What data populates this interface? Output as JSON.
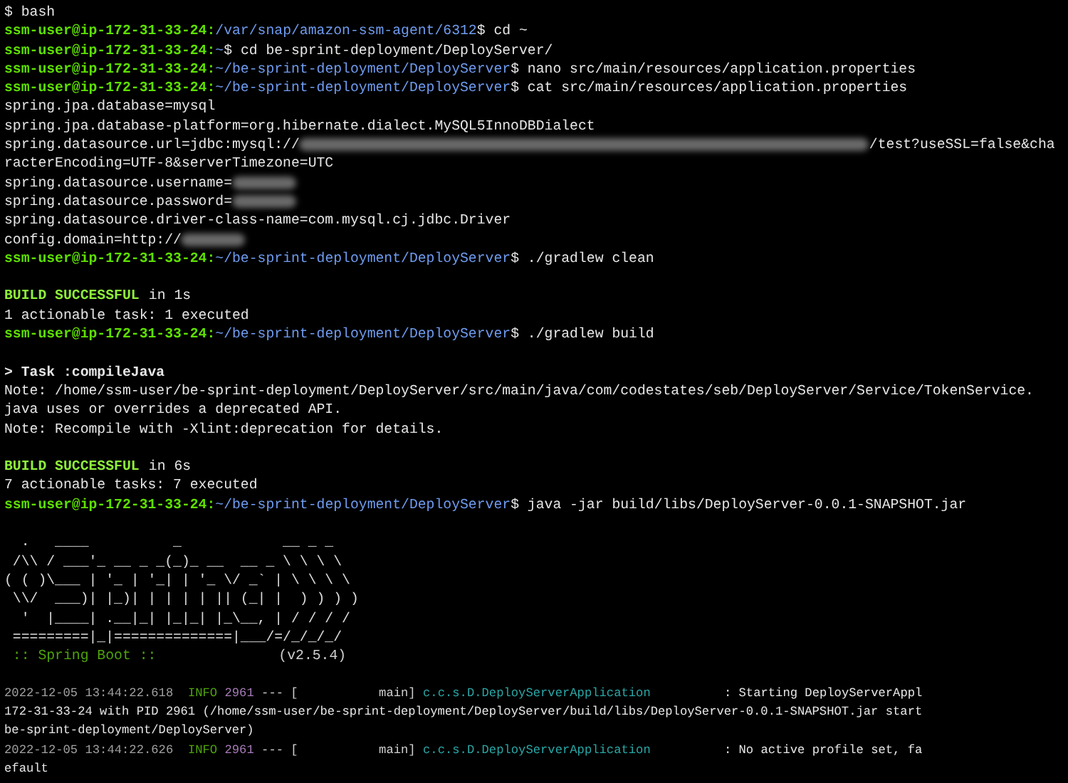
{
  "terminal": {
    "lines": [
      {
        "kind": "output",
        "text": "$ bash"
      },
      {
        "kind": "prompt",
        "host": "ssm-user@ip-172-31-33-24:",
        "path": "/var/snap/amazon-ssm-agent/6312",
        "command": "$ cd ~"
      },
      {
        "kind": "prompt",
        "host": "ssm-user@ip-172-31-33-24:",
        "path": "~",
        "command": "$ cd be-sprint-deployment/DeployServer/"
      },
      {
        "kind": "prompt",
        "host": "ssm-user@ip-172-31-33-24:",
        "path": "~/be-sprint-deployment/DeployServer",
        "command": "$ nano src/main/resources/application.properties"
      },
      {
        "kind": "prompt",
        "host": "ssm-user@ip-172-31-33-24:",
        "path": "~/be-sprint-deployment/DeployServer",
        "command": "$ cat src/main/resources/application.properties"
      },
      {
        "kind": "output",
        "text": "spring.jpa.database=mysql"
      },
      {
        "kind": "output",
        "text": "spring.jpa.database-platform=org.hibernate.dialect.MySQL5InnoDBDialect"
      },
      {
        "kind": "redacted",
        "prefix": "spring.datasource.url=jdbc:mysql://",
        "suffix": "/test?useSSL=false&cha"
      },
      {
        "kind": "output",
        "text": "racterEncoding=UTF-8&serverTimezone=UTC"
      },
      {
        "kind": "redacted",
        "prefix": "spring.datasource.username="
      },
      {
        "kind": "redacted",
        "prefix": "spring.datasource.password="
      },
      {
        "kind": "output",
        "text": "spring.datasource.driver-class-name=com.mysql.cj.jdbc.Driver"
      },
      {
        "kind": "redacted",
        "prefix": "config.domain=http://"
      },
      {
        "kind": "prompt",
        "host": "ssm-user@ip-172-31-33-24:",
        "path": "~/be-sprint-deployment/DeployServer",
        "command": "$ ./gradlew clean"
      },
      {
        "kind": "blank"
      },
      {
        "kind": "success",
        "status": "BUILD SUCCESSFUL",
        "text": "in 1s"
      },
      {
        "kind": "output",
        "text": "1 actionable task: 1 executed"
      },
      {
        "kind": "prompt",
        "host": "ssm-user@ip-172-31-33-24:",
        "path": "~/be-sprint-deployment/DeployServer",
        "command": "$ ./gradlew build"
      },
      {
        "kind": "blank"
      },
      {
        "kind": "task",
        "text": "> Task :compileJava"
      },
      {
        "kind": "output",
        "text": "Note: /home/ssm-user/be-sprint-deployment/DeployServer/src/main/java/com/codestates/seb/DeployServer/Service/TokenService."
      },
      {
        "kind": "output",
        "text": "java uses or overrides a deprecated API."
      },
      {
        "kind": "output",
        "text": "Note: Recompile with -Xlint:deprecation for details."
      },
      {
        "kind": "blank"
      },
      {
        "kind": "success",
        "status": "BUILD SUCCESSFUL",
        "text": "in 6s"
      },
      {
        "kind": "output",
        "text": "7 actionable tasks: 7 executed"
      },
      {
        "kind": "prompt",
        "host": "ssm-user@ip-172-31-33-24:",
        "path": "~/be-sprint-deployment/DeployServer",
        "command": "$ java -jar build/libs/DeployServer-0.0.1-SNAPSHOT.jar"
      },
      {
        "kind": "blank"
      },
      {
        "kind": "banner",
        "text": "  .   ____          _            __ _ _"
      },
      {
        "kind": "banner",
        "text": " /\\\\ / ___'_ __ _ _(_)_ __  __ _ \\ \\ \\ \\"
      },
      {
        "kind": "banner",
        "text": "( ( )\\___ | '_ | '_| | '_ \\/ _` | \\ \\ \\ \\"
      },
      {
        "kind": "banner",
        "text": " \\\\/  ___)| |_)| | | | | || (_| |  ) ) ) )"
      },
      {
        "kind": "banner",
        "text": "  '  |____| .__|_| |_|_| |_\\__, | / / / /"
      },
      {
        "kind": "banner",
        "text": " =========|_|==============|___/=/_/_/_/"
      },
      {
        "kind": "boot",
        "label": " :: Spring Boot ::",
        "version": "(v2.5.4)"
      },
      {
        "kind": "blank"
      },
      {
        "kind": "log",
        "time": "2022-12-05 13:44:22.618",
        "level": "INFO",
        "pid": "2961",
        "thread": "--- [           main]",
        "logger": "c.c.s.D.DeployServerApplication",
        "message": ": Starting DeployServerAppl"
      },
      {
        "kind": "output",
        "text": "172-31-33-24 with PID 2961 (/home/ssm-user/be-sprint-deployment/DeployServer/build/libs/DeployServer-0.0.1-SNAPSHOT.jar start",
        "small": true
      },
      {
        "kind": "output",
        "text": "be-sprint-deployment/DeployServer)",
        "small": true
      },
      {
        "kind": "log",
        "time": "2022-12-05 13:44:22.626",
        "level": "INFO",
        "pid": "2961",
        "thread": "--- [           main]",
        "logger": "c.c.s.D.DeployServerApplication",
        "message": ": No active profile set, fa"
      },
      {
        "kind": "output",
        "text": "efault",
        "small": true
      }
    ]
  }
}
